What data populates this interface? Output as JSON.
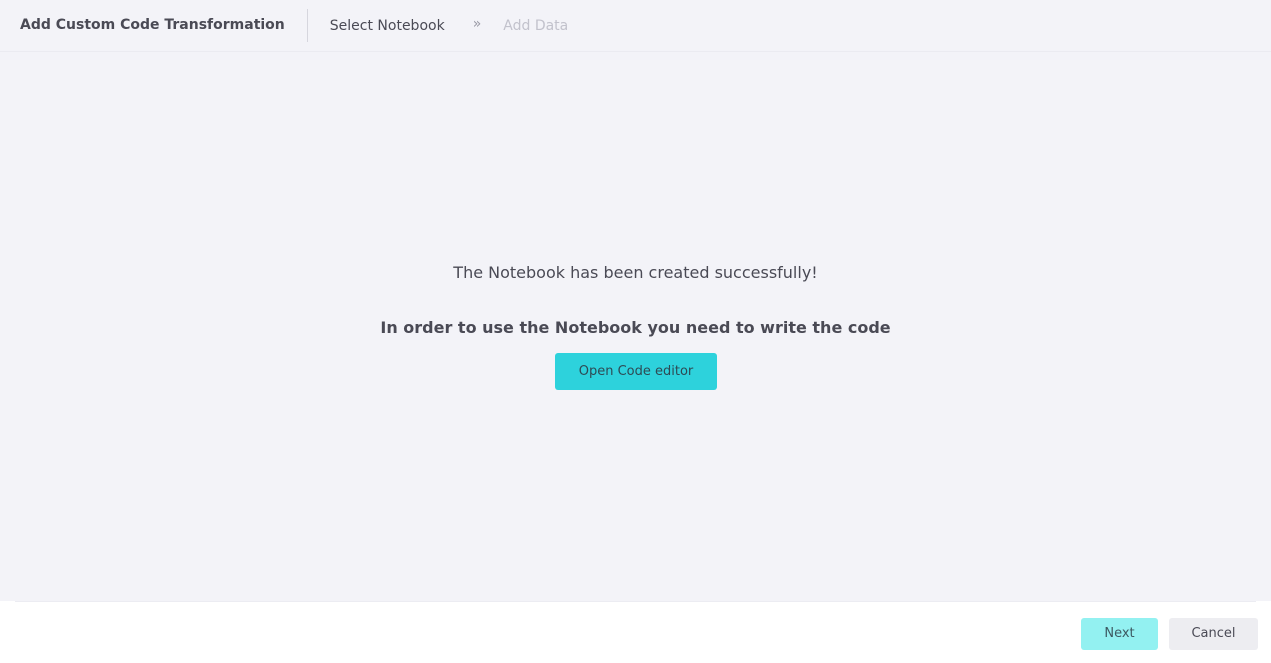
{
  "header": {
    "title": "Add Custom Code Transformation",
    "steps": [
      {
        "label": "Select Notebook",
        "state": "active"
      },
      {
        "label": "Add Data",
        "state": "inactive"
      }
    ],
    "step_separator": "»"
  },
  "content": {
    "success_message": "The Notebook has been created successfully!",
    "instruction": "In order to use the Notebook you need to write the code",
    "open_editor_label": "Open Code editor"
  },
  "footer": {
    "next_label": "Next",
    "cancel_label": "Cancel"
  },
  "colors": {
    "background": "#f3f3f8",
    "accent": "#2dd2dc",
    "accent_disabled": "#93f1f1",
    "text": "#4a4a55",
    "text_inactive": "#c2c2cc"
  }
}
